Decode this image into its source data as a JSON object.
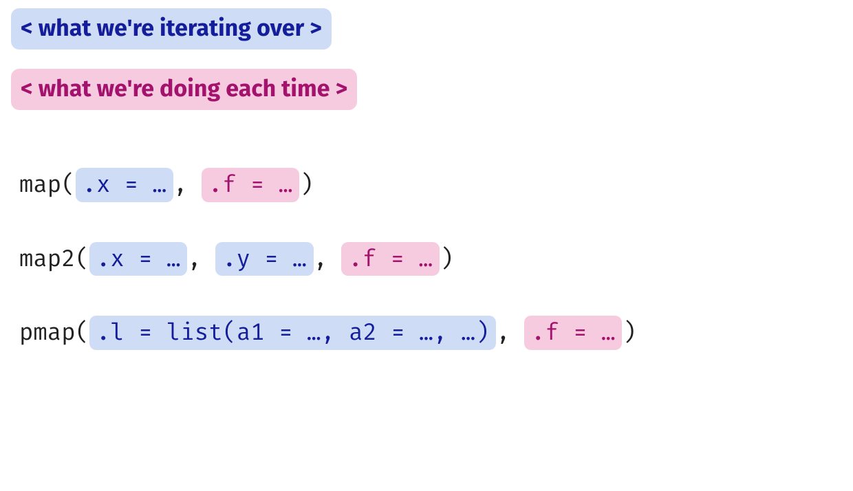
{
  "legend": {
    "iterating": "< what we're iterating over >",
    "doing": "< what we're doing each time >"
  },
  "code": {
    "map": {
      "fn": "map",
      "open": "(",
      "x": ".x = …",
      "sep1": ", ",
      "f": ".f = …",
      "close": ")"
    },
    "map2": {
      "fn": "map2",
      "open": "(",
      "x": ".x = …",
      "sep1": ", ",
      "y": ".y = …",
      "sep2": ", ",
      "f": ".f = …",
      "close": ")"
    },
    "pmap": {
      "fn": "pmap",
      "open": "(",
      "l": ".l = list(a1 = …, a2 = …, …)",
      "sep1": ", ",
      "f": ".f = …",
      "close": ")"
    }
  }
}
